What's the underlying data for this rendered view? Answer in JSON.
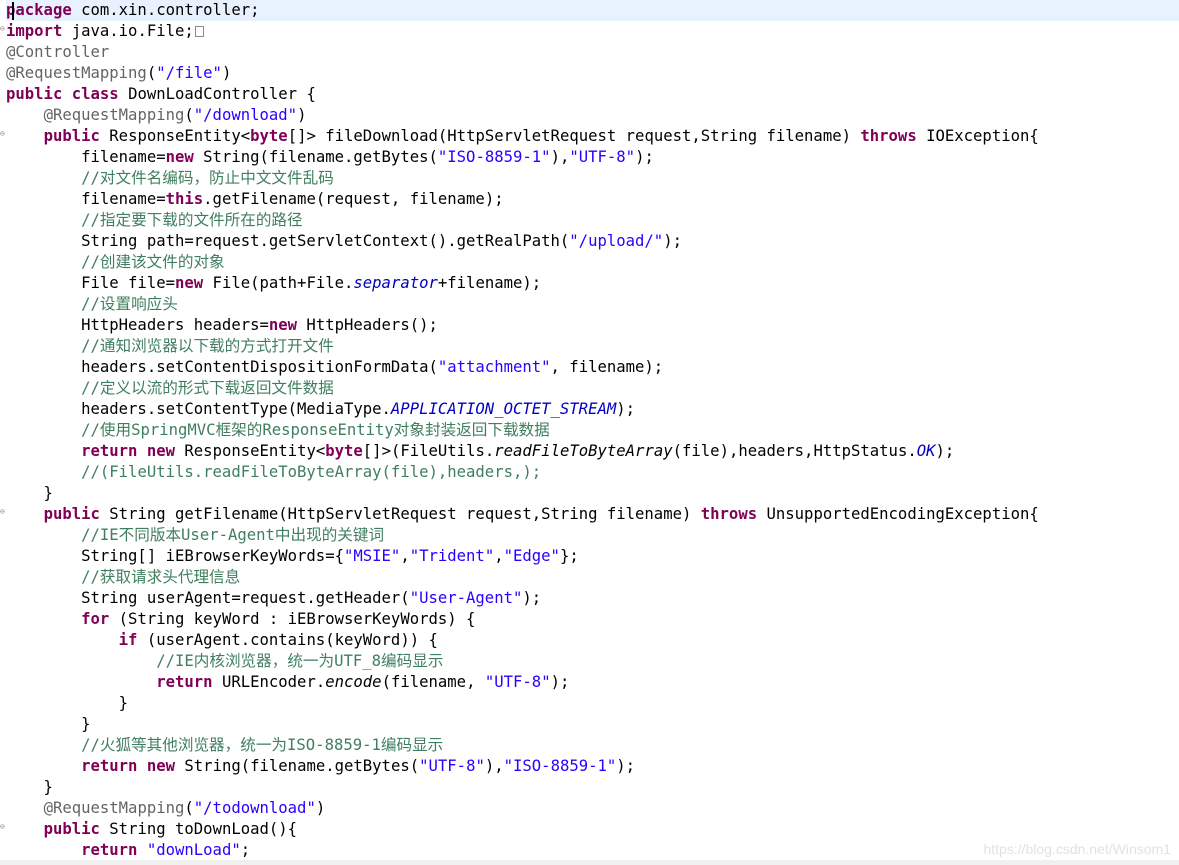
{
  "editor": {
    "language": "java",
    "lines": [
      [
        {
          "t": "package",
          "c": "kw"
        },
        {
          "t": " com.xin.controller;",
          "c": ""
        }
      ],
      [
        {
          "t": "import",
          "c": "kw"
        },
        {
          "t": " java.io.File;",
          "c": ""
        },
        {
          "t": "",
          "c": "fold"
        }
      ],
      [
        {
          "t": "@Controller",
          "c": "ann"
        }
      ],
      [
        {
          "t": "@RequestMapping",
          "c": "ann"
        },
        {
          "t": "(",
          "c": ""
        },
        {
          "t": "\"/file\"",
          "c": "str"
        },
        {
          "t": ")",
          "c": ""
        }
      ],
      [
        {
          "t": "public",
          "c": "kw"
        },
        {
          "t": " ",
          "c": ""
        },
        {
          "t": "class",
          "c": "kw"
        },
        {
          "t": " DownLoadController {",
          "c": ""
        }
      ],
      [
        {
          "t": "    ",
          "c": ""
        },
        {
          "t": "@RequestMapping",
          "c": "ann"
        },
        {
          "t": "(",
          "c": ""
        },
        {
          "t": "\"/download\"",
          "c": "str"
        },
        {
          "t": ")",
          "c": ""
        }
      ],
      [
        {
          "t": "    ",
          "c": ""
        },
        {
          "t": "public",
          "c": "kw"
        },
        {
          "t": " ResponseEntity<",
          "c": ""
        },
        {
          "t": "byte",
          "c": "kw"
        },
        {
          "t": "[]> fileDownload(HttpServletRequest request,String filename) ",
          "c": ""
        },
        {
          "t": "throws",
          "c": "kw"
        },
        {
          "t": " IOException{",
          "c": ""
        }
      ],
      [
        {
          "t": "        filename=",
          "c": ""
        },
        {
          "t": "new",
          "c": "kw"
        },
        {
          "t": " String(filename.getBytes(",
          "c": ""
        },
        {
          "t": "\"ISO-8859-1\"",
          "c": "str"
        },
        {
          "t": "),",
          "c": ""
        },
        {
          "t": "\"UTF-8\"",
          "c": "str"
        },
        {
          "t": ");",
          "c": ""
        }
      ],
      [
        {
          "t": "        ",
          "c": ""
        },
        {
          "t": "//对文件名编码，防止中文文件乱码",
          "c": "cm"
        }
      ],
      [
        {
          "t": "        filename=",
          "c": ""
        },
        {
          "t": "this",
          "c": "kw"
        },
        {
          "t": ".getFilename(request, filename);",
          "c": ""
        }
      ],
      [
        {
          "t": "        ",
          "c": ""
        },
        {
          "t": "//指定要下载的文件所在的路径",
          "c": "cm"
        }
      ],
      [
        {
          "t": "        String path=request.getServletContext().getRealPath(",
          "c": ""
        },
        {
          "t": "\"/upload/\"",
          "c": "str"
        },
        {
          "t": ");",
          "c": ""
        }
      ],
      [
        {
          "t": "        ",
          "c": ""
        },
        {
          "t": "//创建该文件的对象",
          "c": "cm"
        }
      ],
      [
        {
          "t": "        File file=",
          "c": ""
        },
        {
          "t": "new",
          "c": "kw"
        },
        {
          "t": " File(path+File.",
          "c": ""
        },
        {
          "t": "separator",
          "c": "it"
        },
        {
          "t": "+filename);",
          "c": ""
        }
      ],
      [
        {
          "t": "        ",
          "c": ""
        },
        {
          "t": "//设置响应头",
          "c": "cm"
        }
      ],
      [
        {
          "t": "        HttpHeaders headers=",
          "c": ""
        },
        {
          "t": "new",
          "c": "kw"
        },
        {
          "t": " HttpHeaders();",
          "c": ""
        }
      ],
      [
        {
          "t": "        ",
          "c": ""
        },
        {
          "t": "//通知浏览器以下载的方式打开文件",
          "c": "cm"
        }
      ],
      [
        {
          "t": "        headers.setContentDispositionFormData(",
          "c": ""
        },
        {
          "t": "\"attachment\"",
          "c": "str"
        },
        {
          "t": ", filename);",
          "c": ""
        }
      ],
      [
        {
          "t": "        ",
          "c": ""
        },
        {
          "t": "//定义以流的形式下载返回文件数据",
          "c": "cm"
        }
      ],
      [
        {
          "t": "        headers.setContentType(MediaType.",
          "c": ""
        },
        {
          "t": "APPLICATION_OCTET_STREAM",
          "c": "it"
        },
        {
          "t": ");",
          "c": ""
        }
      ],
      [
        {
          "t": "        ",
          "c": ""
        },
        {
          "t": "//使用SpringMVC框架的ResponseEntity对象封装返回下载数据",
          "c": "cm"
        }
      ],
      [
        {
          "t": "        ",
          "c": ""
        },
        {
          "t": "return",
          "c": "kw"
        },
        {
          "t": " ",
          "c": ""
        },
        {
          "t": "new",
          "c": "kw"
        },
        {
          "t": " ResponseEntity<",
          "c": ""
        },
        {
          "t": "byte",
          "c": "kw"
        },
        {
          "t": "[]>(FileUtils.",
          "c": ""
        },
        {
          "t": "readFileToByteArray",
          "c": "mi"
        },
        {
          "t": "(file),headers,HttpStatus.",
          "c": ""
        },
        {
          "t": "OK",
          "c": "it"
        },
        {
          "t": ");",
          "c": ""
        }
      ],
      [
        {
          "t": "        ",
          "c": ""
        },
        {
          "t": "//(FileUtils.readFileToByteArray(file),headers,);",
          "c": "cm"
        }
      ],
      [
        {
          "t": "    }",
          "c": ""
        }
      ],
      [
        {
          "t": "    ",
          "c": ""
        },
        {
          "t": "public",
          "c": "kw"
        },
        {
          "t": " String getFilename(HttpServletRequest request,String filename) ",
          "c": ""
        },
        {
          "t": "throws",
          "c": "kw"
        },
        {
          "t": " UnsupportedEncodingException{",
          "c": ""
        }
      ],
      [
        {
          "t": "        ",
          "c": ""
        },
        {
          "t": "//IE不同版本User-Agent中出现的关键词",
          "c": "cm"
        }
      ],
      [
        {
          "t": "        String[] iEBrowserKeyWords={",
          "c": ""
        },
        {
          "t": "\"MSIE\"",
          "c": "str"
        },
        {
          "t": ",",
          "c": ""
        },
        {
          "t": "\"Trident\"",
          "c": "str"
        },
        {
          "t": ",",
          "c": ""
        },
        {
          "t": "\"Edge\"",
          "c": "str"
        },
        {
          "t": "};",
          "c": ""
        }
      ],
      [
        {
          "t": "        ",
          "c": ""
        },
        {
          "t": "//获取请求头代理信息",
          "c": "cm"
        }
      ],
      [
        {
          "t": "        String userAgent=request.getHeader(",
          "c": ""
        },
        {
          "t": "\"User-Agent\"",
          "c": "str"
        },
        {
          "t": ");",
          "c": ""
        }
      ],
      [
        {
          "t": "        ",
          "c": ""
        },
        {
          "t": "for",
          "c": "kw"
        },
        {
          "t": " (String keyWord : iEBrowserKeyWords) {",
          "c": ""
        }
      ],
      [
        {
          "t": "            ",
          "c": ""
        },
        {
          "t": "if",
          "c": "kw"
        },
        {
          "t": " (userAgent.contains(keyWord)) {",
          "c": ""
        }
      ],
      [
        {
          "t": "                ",
          "c": ""
        },
        {
          "t": "//IE内核浏览器，统一为UTF_8编码显示",
          "c": "cm"
        }
      ],
      [
        {
          "t": "                ",
          "c": ""
        },
        {
          "t": "return",
          "c": "kw"
        },
        {
          "t": " URLEncoder.",
          "c": ""
        },
        {
          "t": "encode",
          "c": "mi"
        },
        {
          "t": "(filename, ",
          "c": ""
        },
        {
          "t": "\"UTF-8\"",
          "c": "str"
        },
        {
          "t": ");",
          "c": ""
        }
      ],
      [
        {
          "t": "            }",
          "c": ""
        }
      ],
      [
        {
          "t": "        }",
          "c": ""
        }
      ],
      [
        {
          "t": "        ",
          "c": ""
        },
        {
          "t": "//火狐等其他浏览器，统一为ISO-8859-1编码显示",
          "c": "cm"
        }
      ],
      [
        {
          "t": "        ",
          "c": ""
        },
        {
          "t": "return",
          "c": "kw"
        },
        {
          "t": " ",
          "c": ""
        },
        {
          "t": "new",
          "c": "kw"
        },
        {
          "t": " String(filename.getBytes(",
          "c": ""
        },
        {
          "t": "\"UTF-8\"",
          "c": "str"
        },
        {
          "t": "),",
          "c": ""
        },
        {
          "t": "\"ISO-8859-1\"",
          "c": "str"
        },
        {
          "t": ");",
          "c": ""
        }
      ],
      [
        {
          "t": "    }",
          "c": ""
        }
      ],
      [
        {
          "t": "    ",
          "c": ""
        },
        {
          "t": "@RequestMapping",
          "c": "ann"
        },
        {
          "t": "(",
          "c": ""
        },
        {
          "t": "\"/todownload\"",
          "c": "str"
        },
        {
          "t": ")",
          "c": ""
        }
      ],
      [
        {
          "t": "    ",
          "c": ""
        },
        {
          "t": "public",
          "c": "kw"
        },
        {
          "t": " String toDownLoad(){",
          "c": ""
        }
      ],
      [
        {
          "t": "        ",
          "c": ""
        },
        {
          "t": "return",
          "c": "kw"
        },
        {
          "t": " ",
          "c": ""
        },
        {
          "t": "\"downLoad\"",
          "c": "str"
        },
        {
          "t": ";",
          "c": ""
        }
      ]
    ],
    "fold_markers_on_lines": [
      1,
      6,
      24,
      39
    ],
    "current_line": 0
  },
  "watermark": "https://blog.csdn.net/Winsom1",
  "colors": {
    "keyword": "#7f0055",
    "string": "#2a00ff",
    "comment": "#3f7f5f",
    "annotation": "#646464",
    "static_field": "#0000c0",
    "current_line_bg": "#e8f2fe"
  }
}
